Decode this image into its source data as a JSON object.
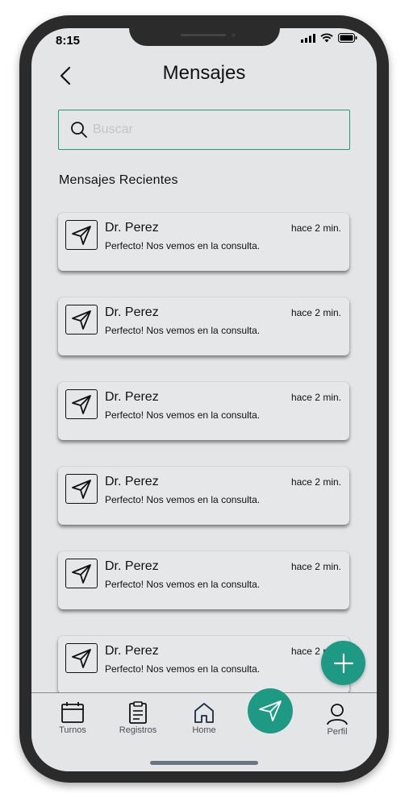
{
  "status": {
    "time": "8:15"
  },
  "header": {
    "title": "Mensajes"
  },
  "search": {
    "placeholder": "Buscar"
  },
  "section_title": "Mensajes Recientes",
  "messages": [
    {
      "name": "Dr. Perez",
      "time": "hace 2 min.",
      "text": "Perfecto! Nos vemos en la consulta."
    },
    {
      "name": "Dr. Perez",
      "time": "hace 2 min.",
      "text": "Perfecto! Nos vemos en la consulta."
    },
    {
      "name": "Dr. Perez",
      "time": "hace 2 min.",
      "text": "Perfecto! Nos vemos en la consulta."
    },
    {
      "name": "Dr. Perez",
      "time": "hace 2 min.",
      "text": "Perfecto! Nos vemos en la consulta."
    },
    {
      "name": "Dr. Perez",
      "time": "hace 2 min.",
      "text": "Perfecto! Nos vemos en la consulta."
    },
    {
      "name": "Dr. Perez",
      "time": "hace 2 min.",
      "text": "Perfecto! Nos vemos en la consulta."
    }
  ],
  "tabbar": {
    "turnos": "Turnos",
    "registros": "Registros",
    "home": "Home",
    "perfil": "Perfil"
  },
  "colors": {
    "accent": "#1e9a84",
    "background": "#e4e5e7"
  }
}
